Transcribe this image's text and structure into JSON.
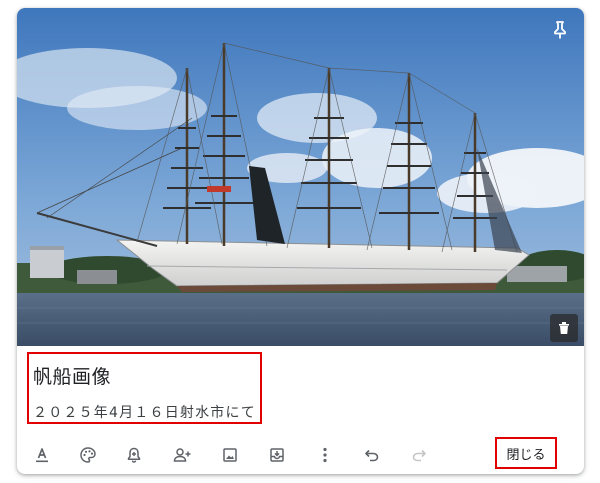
{
  "note": {
    "title": "帆船画像",
    "body": "２０２５年4月１６日射水市にて"
  },
  "toolbar": {
    "close_label": "閉じる",
    "icons": [
      "text-format-icon",
      "palette-icon",
      "reminder-icon",
      "collaborator-icon",
      "image-icon",
      "archive-icon",
      "more-icon",
      "undo-icon",
      "redo-icon"
    ]
  },
  "image": {
    "subject": "tall ship photo"
  },
  "colors": {
    "highlight": "#e00000",
    "icon": "#5f6368",
    "icon_disabled": "#c4c7c5",
    "sky": "#6c9fd2",
    "water": "#4a5e78"
  }
}
